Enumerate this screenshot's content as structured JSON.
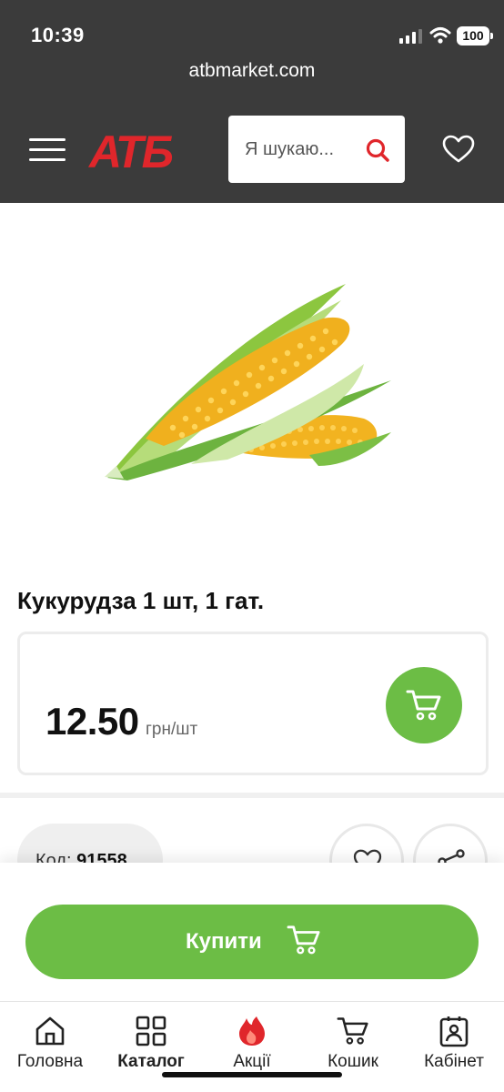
{
  "status_bar": {
    "time": "10:39",
    "battery": "100"
  },
  "browser": {
    "url": "atbmarket.com"
  },
  "header": {
    "logo_text": "АТБ",
    "search_placeholder": "Я шукаю...",
    "icons": [
      "menu-icon",
      "search-icon",
      "heart-icon"
    ]
  },
  "product": {
    "title": "Кукурудза 1 шт, 1 гат.",
    "price": "12.50",
    "price_unit": "грн/шт",
    "code_label": "Код:",
    "code_value": "91558"
  },
  "actions": {
    "buy_label": "Купити"
  },
  "colors": {
    "header_bg": "#3b3b3b",
    "accent_green": "#6cbd45",
    "brand_red": "#e0262b"
  },
  "bottom_nav": {
    "items": [
      {
        "label": "Головна",
        "icon": "home-icon"
      },
      {
        "label": "Каталог",
        "icon": "grid-icon"
      },
      {
        "label": "Акції",
        "icon": "fire-icon"
      },
      {
        "label": "Кошик",
        "icon": "cart-icon"
      },
      {
        "label": "Кабінет",
        "icon": "profile-icon"
      }
    ]
  }
}
